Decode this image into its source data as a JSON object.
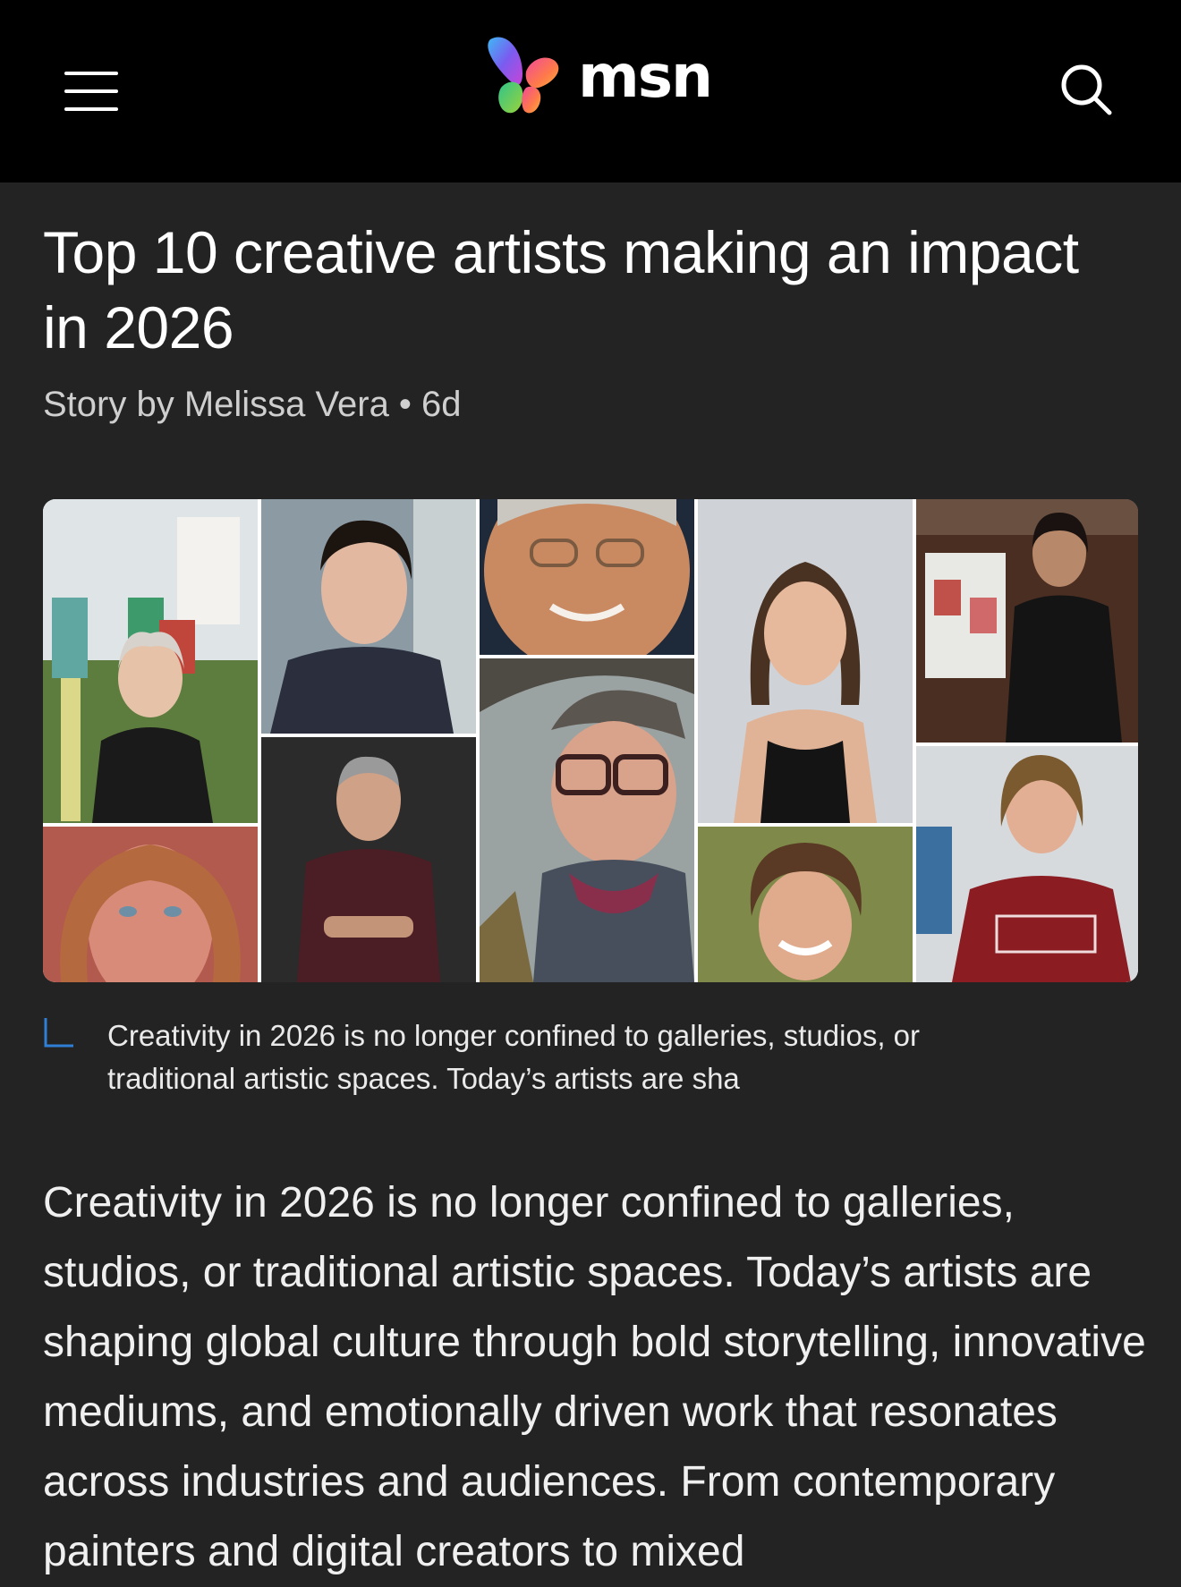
{
  "header": {
    "logo_text": "msn",
    "menu_icon": "hamburger-menu-icon",
    "search_icon": "search-icon",
    "logo_icon": "msn-butterfly-logo"
  },
  "article": {
    "title": "Top 10 creative artists making an impact in 2026",
    "byline": "Story by Melissa Vera • 6d",
    "hero_alt": "Collage of portraits of ten creative artists",
    "caption": "Creativity in 2026 is no longer confined to galleries, studios, or traditional artistic spaces. Today’s artists are sha",
    "caption_icon": "caption-corner-icon",
    "body": "Creativity in 2026 is no longer confined to galleries, studios, or traditional artistic spaces. Today’s artists are shaping global culture through bold storytelling, innovative mediums, and emotionally driven work that resonates across industries and audiences. From contemporary painters and digital creators to mixed"
  },
  "colors": {
    "topbar_bg": "#000000",
    "page_bg": "#232323",
    "caption_accent": "#2f7fd6"
  }
}
